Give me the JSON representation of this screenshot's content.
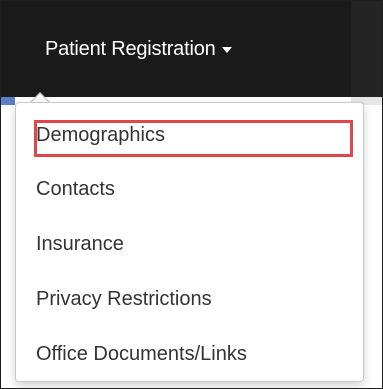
{
  "navbar": {
    "menu_label": "Patient Registration"
  },
  "menu": {
    "items": [
      {
        "label": "Demographics",
        "highlighted": true
      },
      {
        "label": "Contacts"
      },
      {
        "label": "Insurance"
      },
      {
        "label": "Privacy Restrictions"
      },
      {
        "label": "Office Documents/Links"
      }
    ]
  },
  "colors": {
    "navbar": "#1a1a1a",
    "highlight_border": "#e0474c",
    "menu_text": "#333333"
  },
  "icons": {
    "dropdown": "caret-down-icon"
  }
}
